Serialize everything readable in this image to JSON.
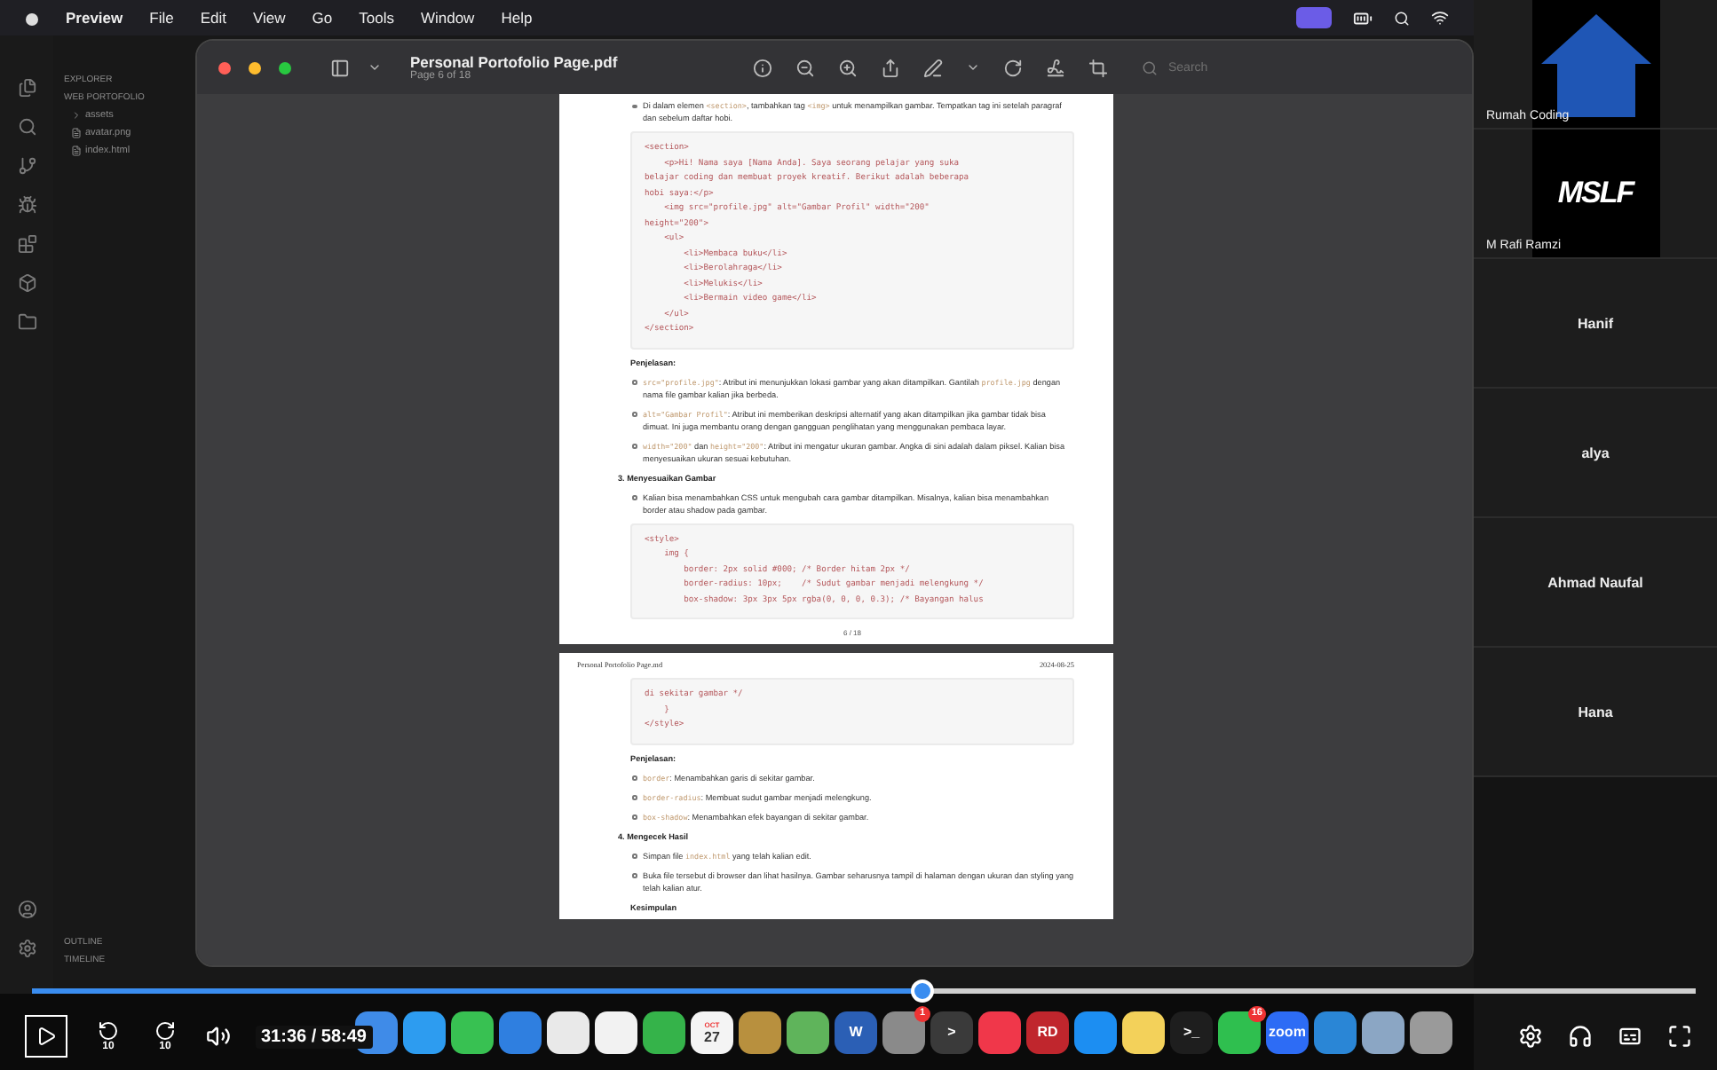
{
  "menu_bar": {
    "app": "Preview",
    "items": [
      "File",
      "Edit",
      "View",
      "Go",
      "Tools",
      "Window",
      "Help"
    ]
  },
  "editor": {
    "explorer_title": "EXPLORER",
    "project": "WEB PORTOFOLIO",
    "files": [
      {
        "name": "assets",
        "kind": "folder"
      },
      {
        "name": "avatar.png",
        "kind": "file"
      },
      {
        "name": "index.html",
        "kind": "file"
      }
    ],
    "outline": "OUTLINE",
    "timeline": "TIMELINE"
  },
  "preview": {
    "title": "Personal Portofolio Page.pdf",
    "subtitle": "Page 6 of 18",
    "search": {
      "placeholder": "Search"
    }
  },
  "pages": [
    {
      "blocks": [
        {
          "kind": "bullet",
          "parts": [
            {
              "kind": "text",
              "text": "Di dalam elemen "
            },
            {
              "kind": "code",
              "text": "<section>"
            },
            {
              "kind": "text",
              "text": ", tambahkan tag "
            },
            {
              "kind": "code",
              "text": "<img>"
            },
            {
              "kind": "text",
              "text": " untuk menampilkan gambar. Tempatkan tag ini setelah paragraf dan sebelum daftar hobi."
            }
          ]
        },
        {
          "kind": "code",
          "lines": [
            "<section>",
            "    <p>Hi! Nama saya [Nama Anda]. Saya seorang pelajar yang suka",
            "belajar coding dan membuat proyek kreatif. Berikut adalah beberapa",
            "hobi saya:</p>",
            "    <img src=\"profile.jpg\" alt=\"Gambar Profil\" width=\"200\"",
            "height=\"200\">",
            "    <ul>",
            "        <li>Membaca buku</li>",
            "        <li>Berolahraga</li>",
            "        <li>Melukis</li>",
            "        <li>Bermain video game</li>",
            "    </ul>",
            "</section>"
          ]
        },
        {
          "kind": "label",
          "text": "Penjelasan:"
        },
        {
          "kind": "bullet",
          "parts": [
            {
              "kind": "code",
              "text": "src=\"profile.jpg\""
            },
            {
              "kind": "text",
              "text": ": Atribut ini menunjukkan lokasi gambar yang akan ditampilkan. Gantilah "
            },
            {
              "kind": "code",
              "text": "profile.jpg"
            },
            {
              "kind": "text",
              "text": " dengan nama file gambar kalian jika berbeda."
            }
          ]
        },
        {
          "kind": "bullet",
          "parts": [
            {
              "kind": "code",
              "text": "alt=\"Gambar Profil\""
            },
            {
              "kind": "text",
              "text": ": Atribut ini memberikan deskripsi alternatif yang akan ditampilkan jika gambar tidak bisa dimuat. Ini juga membantu orang dengan gangguan penglihatan yang menggunakan pembaca layar."
            }
          ]
        },
        {
          "kind": "bullet",
          "parts": [
            {
              "kind": "code",
              "text": "width=\"200\""
            },
            {
              "kind": "text",
              "text": " dan "
            },
            {
              "kind": "code",
              "text": "height=\"200\""
            },
            {
              "kind": "text",
              "text": ": Atribut ini mengatur ukuran gambar. Angka di sini adalah dalam piksel. Kalian bisa menyesuaikan ukuran sesuai kebutuhan."
            }
          ]
        },
        {
          "kind": "heading",
          "text": "3. Menyesuaikan Gambar"
        },
        {
          "kind": "bullet",
          "parts": [
            {
              "kind": "text",
              "text": "Kalian bisa menambahkan CSS untuk mengubah cara gambar ditampilkan. Misalnya, kalian bisa menambahkan border atau shadow pada gambar."
            }
          ]
        },
        {
          "kind": "code",
          "lines": [
            "<style>",
            "    img {",
            "        border: 2px solid #000; /* Border hitam 2px */",
            "        border-radius: 10px;    /* Sudut gambar menjadi melengkung */",
            "        box-shadow: 3px 3px 5px rgba(0, 0, 0, 0.3); /* Bayangan halus"
          ]
        }
      ],
      "footer": "6 / 18"
    },
    {
      "header_left": "Personal Portofolio Page.md",
      "header_right": "2024-08-25",
      "blocks": [
        {
          "kind": "code",
          "lines": [
            "di sekitar gambar */",
            "    }",
            "</style>"
          ]
        },
        {
          "kind": "label",
          "text": "Penjelasan:"
        },
        {
          "kind": "bullet",
          "parts": [
            {
              "kind": "code",
              "text": "border"
            },
            {
              "kind": "text",
              "text": ": Menambahkan garis di sekitar gambar."
            }
          ]
        },
        {
          "kind": "bullet",
          "parts": [
            {
              "kind": "code",
              "text": "border-radius"
            },
            {
              "kind": "text",
              "text": ": Membuat sudut gambar menjadi melengkung."
            }
          ]
        },
        {
          "kind": "bullet",
          "parts": [
            {
              "kind": "code",
              "text": "box-shadow"
            },
            {
              "kind": "text",
              "text": ": Menambahkan efek bayangan di sekitar gambar."
            }
          ]
        },
        {
          "kind": "heading",
          "text": "4. Mengecek Hasil"
        },
        {
          "kind": "bullet",
          "parts": [
            {
              "kind": "text",
              "text": "Simpan file "
            },
            {
              "kind": "code",
              "text": "index.html"
            },
            {
              "kind": "text",
              "text": " yang telah kalian edit."
            }
          ]
        },
        {
          "kind": "bullet",
          "parts": [
            {
              "kind": "text",
              "text": "Buka file tersebut di browser dan lihat hasilnya. Gambar seharusnya tampil di halaman dengan ukuran dan styling yang telah kalian atur."
            }
          ]
        },
        {
          "kind": "label",
          "text": "Kesimpulan"
        }
      ]
    }
  ],
  "participants": [
    {
      "name": "Rumah Coding",
      "kind": "house-logo"
    },
    {
      "name": "M Rafi Ramzi",
      "kind": "text-logo",
      "logo": "MSLF"
    },
    {
      "name": "Hanif",
      "kind": "name-only"
    },
    {
      "name": "alya",
      "kind": "name-only"
    },
    {
      "name": "Ahmad Naufal",
      "kind": "name-only"
    },
    {
      "name": "Hana",
      "kind": "name-only"
    }
  ],
  "dock": [
    {
      "color": "#3f8be8"
    },
    {
      "color": "#2d9cf0"
    },
    {
      "color": "#38c152"
    },
    {
      "color": "#2f7fe0"
    },
    {
      "color": "#e9e9e9"
    },
    {
      "color": "#f2f2f2"
    },
    {
      "color": "#35b34a"
    },
    {
      "color": "#f4f4f4",
      "month": "OCT",
      "label": "27"
    },
    {
      "color": "#b8903e"
    },
    {
      "color": "#5fb45b"
    },
    {
      "color": "#2b5fb5",
      "label": "W"
    },
    {
      "color": "#8a8a8a",
      "badge": "1"
    },
    {
      "color": "#3a3a3a",
      "label": ">"
    },
    {
      "color": "#f0374a"
    },
    {
      "color": "#c0262d",
      "label": "RD"
    },
    {
      "color": "#1c8ef2"
    },
    {
      "color": "#f3d15a"
    },
    {
      "color": "#1e1e1e",
      "label": ">_"
    },
    {
      "color": "#2fbf4f",
      "badge": "16"
    },
    {
      "color": "#2d6cf5",
      "label": "zoom"
    },
    {
      "color": "#2a86d6"
    },
    {
      "color": "#8ba6c4"
    },
    {
      "color": "#9a9a9a"
    }
  ],
  "player": {
    "level": 0.535,
    "rewind_label": "10",
    "forward_label": "10",
    "time": "31:36 / 58:49"
  }
}
